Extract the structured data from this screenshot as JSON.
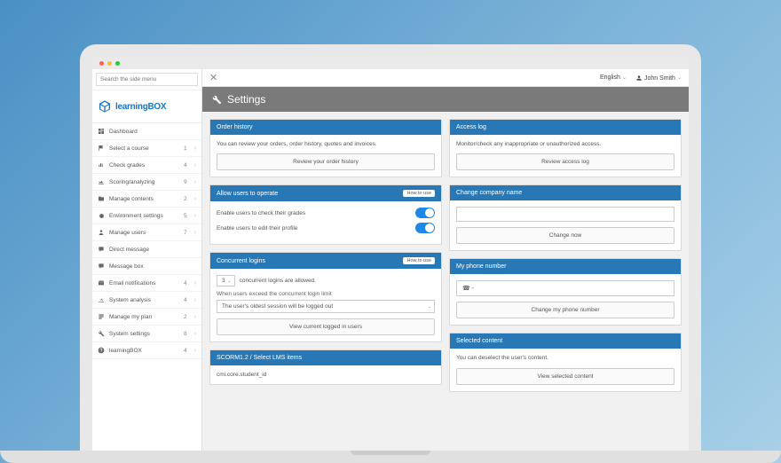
{
  "search": {
    "placeholder": "Search the side menu"
  },
  "logo": {
    "text1": "learning",
    "text2": "BOX"
  },
  "sidebar": {
    "items": [
      {
        "icon": "dashboard",
        "label": "Dashboard",
        "count": "",
        "chev": ""
      },
      {
        "icon": "flag",
        "label": "Select a course",
        "count": "1",
        "chev": "›"
      },
      {
        "icon": "chart",
        "label": "Check grades",
        "count": "4",
        "chev": "›"
      },
      {
        "icon": "analytics",
        "label": "Scoring/analyzing",
        "count": "9",
        "chev": "›"
      },
      {
        "icon": "folder",
        "label": "Manage contents",
        "count": "2",
        "chev": "›"
      },
      {
        "icon": "gear",
        "label": "Environment settings",
        "count": "5",
        "chev": "›"
      },
      {
        "icon": "users",
        "label": "Manage users",
        "count": "7",
        "chev": "›"
      },
      {
        "icon": "message",
        "label": "Direct message",
        "count": "",
        "chev": ""
      },
      {
        "icon": "chat",
        "label": "Message box",
        "count": "",
        "chev": ""
      },
      {
        "icon": "mail",
        "label": "Email notifications",
        "count": "4",
        "chev": "›"
      },
      {
        "icon": "graph",
        "label": "System analysis",
        "count": "4",
        "chev": "›"
      },
      {
        "icon": "plan",
        "label": "Manage my plan",
        "count": "2",
        "chev": "›"
      },
      {
        "icon": "wrench",
        "label": "System settings",
        "count": "8",
        "chev": "›"
      },
      {
        "icon": "help",
        "label": "learningBOX",
        "count": "4",
        "chev": "›"
      }
    ]
  },
  "topbar": {
    "language": "English",
    "user": "John Smith"
  },
  "header": {
    "title": "Settings"
  },
  "panels": {
    "order_history": {
      "title": "Order history",
      "desc": "You can review your orders, order history, quotes and invoices.",
      "button": "Review your order history"
    },
    "access_log": {
      "title": "Access log",
      "desc": "Monitor/check any inappropriate or unauthorized access.",
      "button": "Review access log"
    },
    "allow_operate": {
      "title": "Allow users to operate",
      "howto": "How to use",
      "toggle1": "Enable users to check their grades",
      "toggle2": "Enable users to edit their profile"
    },
    "company_name": {
      "title": "Change company name",
      "button": "Change now"
    },
    "concurrent": {
      "title": "Concurrent logins",
      "howto": "How to use",
      "select_value": "3",
      "select_suffix": "concurrent logins are allowed.",
      "sublabel": "When users exceed the concurrent login limit",
      "policy": "The user's oldest session will be logged out",
      "button": "View current logged in users"
    },
    "phone": {
      "title": "My phone number",
      "value": "☎ -",
      "button": "Change my phone number"
    },
    "scorm": {
      "title": "SCORM1.2 / Select LMS items",
      "line1": "cmi.core.student_id"
    },
    "selected_content": {
      "title": "Selected content",
      "desc": "You can deselect the user's content.",
      "button": "View selected content"
    }
  }
}
